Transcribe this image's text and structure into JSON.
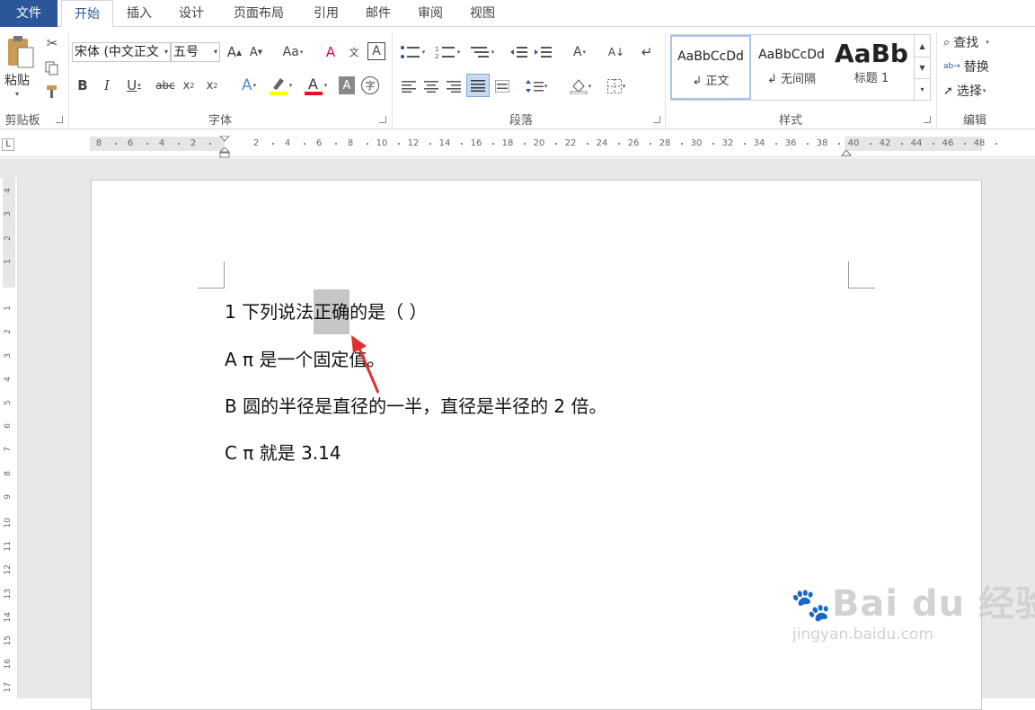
{
  "tabs": [
    "文件",
    "开始",
    "插入",
    "设计",
    "页面布局",
    "引用",
    "邮件",
    "审阅",
    "视图"
  ],
  "clipboard": {
    "paste": "粘贴",
    "label": "剪贴板"
  },
  "font": {
    "name": "宋体 (中文正文",
    "size": "五号",
    "label": "字体",
    "case_label": "Aa",
    "highlight_color": "#ffff00",
    "font_color": "#e81123"
  },
  "paragraph": {
    "label": "段落"
  },
  "styles": {
    "label": "样式",
    "items": [
      {
        "preview": "AaBbCcDd",
        "name": "↲ 正文"
      },
      {
        "preview": "AaBbCcDd",
        "name": "↲ 无间隔"
      },
      {
        "preview": "AaBb",
        "name": "标题 1"
      }
    ]
  },
  "editing": {
    "find": "查找",
    "replace": "替换",
    "select": "选择",
    "label": "编辑"
  },
  "ruler": {
    "marks": [
      "8",
      "6",
      "4",
      "2",
      "2",
      "4",
      "6",
      "8",
      "10",
      "12",
      "14",
      "16",
      "18",
      "20",
      "22",
      "24",
      "26",
      "28",
      "30",
      "32",
      "34",
      "36",
      "38",
      "40",
      "42",
      "44",
      "46",
      "48"
    ]
  },
  "vruler": {
    "marks": [
      "4",
      "3",
      "2",
      "1",
      "1",
      "2",
      "3",
      "4",
      "5",
      "6",
      "7",
      "8",
      "9",
      "10",
      "11",
      "12",
      "13",
      "14",
      "15",
      "16",
      "17"
    ]
  },
  "document": {
    "q1": {
      "before": "1 下列说法",
      "selected": "正确",
      "after": "的是（    ）"
    },
    "a": "A π 是一个固定值。",
    "b": "B  圆的半径是直径的一半，直径是半径的 2 倍。",
    "c": "C π 就是 3.14"
  },
  "watermark": {
    "brand": "Bai du 经验",
    "url": "jingyan.baidu.com"
  }
}
